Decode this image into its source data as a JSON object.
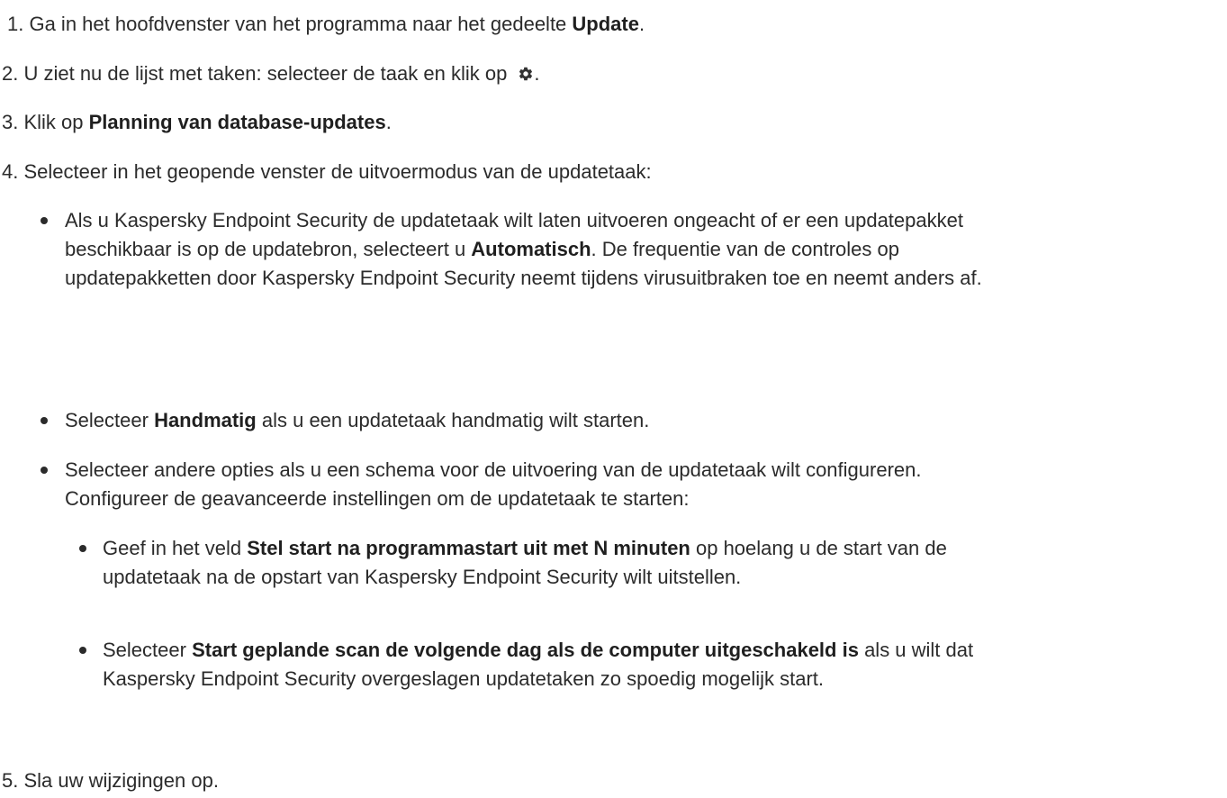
{
  "steps": {
    "s1": {
      "num": "1.",
      "pre": " Ga in het hoofdvenster van het programma naar het gedeelte ",
      "bold": "Update",
      "post": "."
    },
    "s2": {
      "num": "2.",
      "pre": " U ziet nu de lijst met taken: selecteer de taak en klik op ",
      "icon": "gear-icon",
      "post": "."
    },
    "s3": {
      "num": "3.",
      "pre": " Klik op ",
      "bold": "Planning van database-updates",
      "post": "."
    },
    "s4": {
      "num": "4.",
      "pre": " Selecteer in het geopende venster de uitvoermodus van de updatetaak:"
    },
    "s5": {
      "num": "5.",
      "pre": " Sla uw wijzigingen op."
    }
  },
  "bullets": {
    "auto": {
      "l1": "Als u Kaspersky Endpoint Security de updatetaak wilt laten uitvoeren ongeacht of er een updatepakket",
      "l2_pre": "beschikbaar is op de updatebron, selecteert u ",
      "l2_bold": "Automatisch",
      "l2_post": ". De frequentie van de controles op",
      "l3": "updatepakketten door Kaspersky Endpoint Security neemt tijdens virusuitbraken toe en neemt anders af."
    },
    "manual": {
      "pre": "Selecteer ",
      "bold": "Handmatig",
      "post": " als u een updatetaak handmatig wilt starten."
    },
    "schedule": {
      "l1": "Selecteer andere opties als u een schema voor de uitvoering van de updatetaak wilt configureren.",
      "l2": "Configureer de geavanceerde instellingen om de updatetaak te starten:"
    }
  },
  "subbullets": {
    "delay": {
      "pre": "Geef in het veld ",
      "bold": "Stel start na programmastart uit met N minuten",
      "post": " op hoelang u de start van de",
      "l2": "updatetaak na de opstart van Kaspersky Endpoint Security wilt uitstellen."
    },
    "nextday": {
      "pre": "Selecteer ",
      "bold": "Start geplande scan de volgende dag als de computer uitgeschakeld is",
      "post": " als u wilt dat",
      "l2": "Kaspersky Endpoint Security overgeslagen updatetaken zo spoedig mogelijk start."
    }
  }
}
